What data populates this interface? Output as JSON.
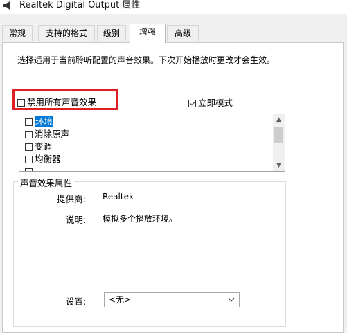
{
  "window": {
    "title": "Realtek Digital Output 属性"
  },
  "tabs": [
    {
      "label": "常规"
    },
    {
      "label": "支持的格式"
    },
    {
      "label": "级别"
    },
    {
      "label": "增强"
    },
    {
      "label": "高级"
    }
  ],
  "active_tab": "增强",
  "description": "选择适用于当前聆听配置的声音效果。下次开始播放时更改才会生效。",
  "disable_all": {
    "label": "禁用所有声音效果",
    "checked": false
  },
  "immediate_mode": {
    "label": "立即模式",
    "checked": true
  },
  "effects": [
    {
      "label": "环境",
      "checked": false,
      "selected": true
    },
    {
      "label": "消除原声",
      "checked": false
    },
    {
      "label": "变调",
      "checked": false
    },
    {
      "label": "均衡器",
      "checked": false
    }
  ],
  "properties": {
    "title": "声音效果属性",
    "provider_label": "提供商:",
    "provider_value": "Realtek",
    "description_label": "说明:",
    "description_value": "模拟多个播放环境。",
    "settings_label": "设置:",
    "settings_value": "<无>"
  },
  "colors": {
    "highlight": "#e02020",
    "selection": "#0078d7"
  }
}
